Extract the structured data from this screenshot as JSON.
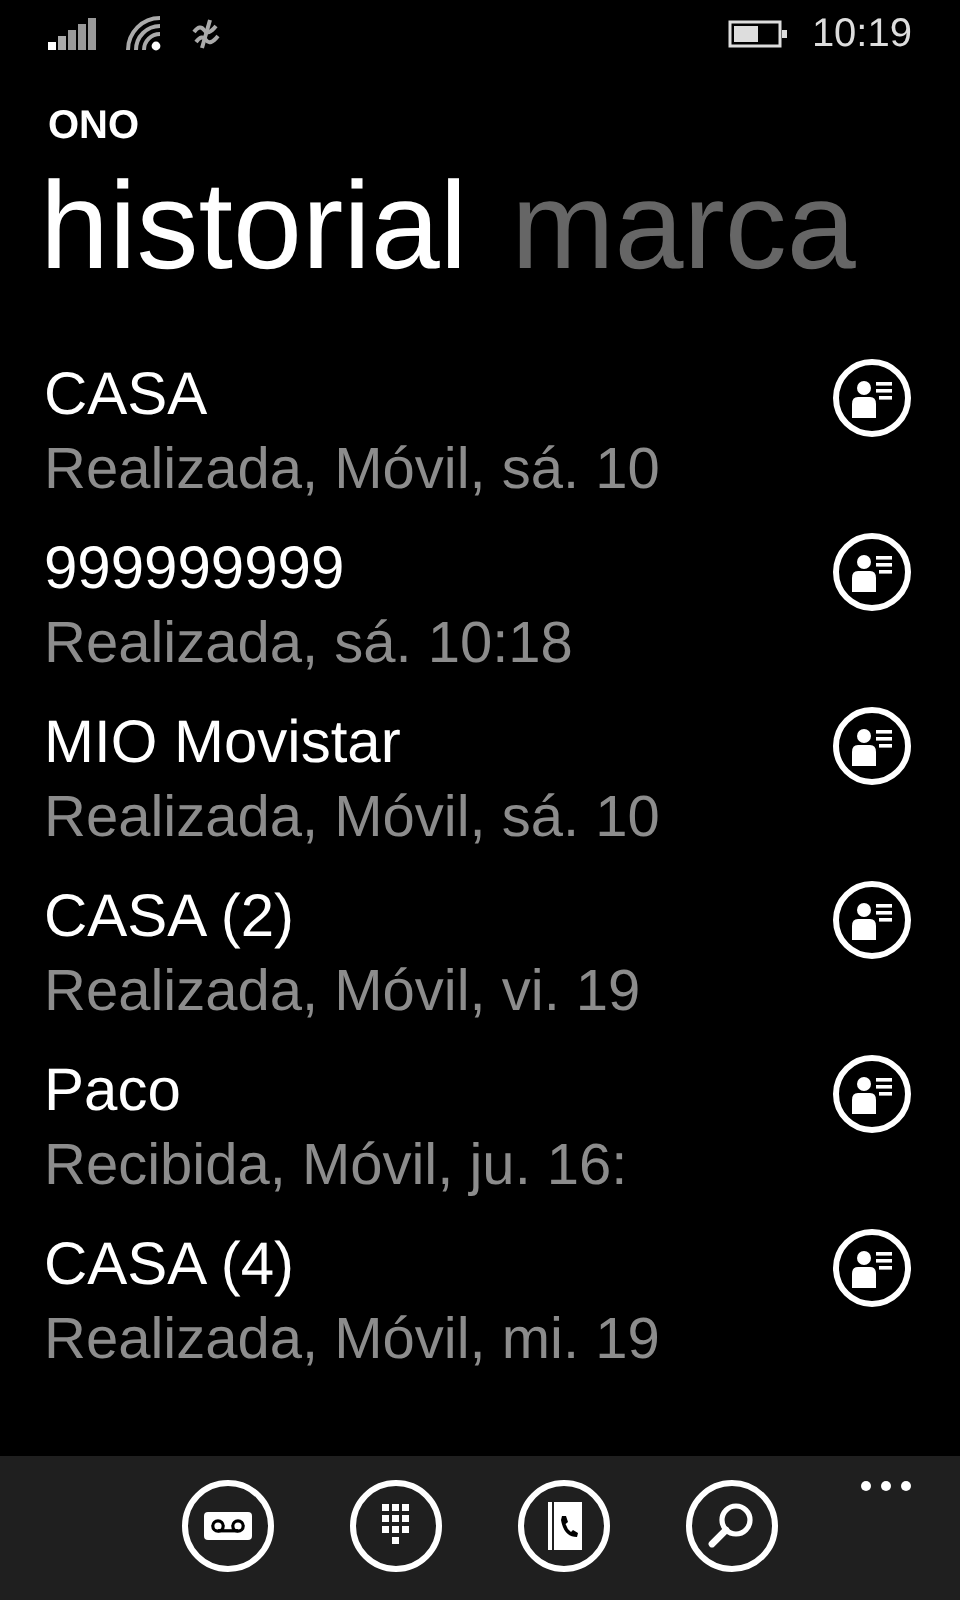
{
  "status_bar": {
    "time": "10:19"
  },
  "app_title": "ONO",
  "pivot": [
    {
      "label": "historial",
      "selected": true
    },
    {
      "label": "marca",
      "selected": false
    }
  ],
  "calls": [
    {
      "name": "CASA",
      "detail": "Realizada, Móvil, sá. 10"
    },
    {
      "name": "999999999",
      "detail": "Realizada, sá. 10:18"
    },
    {
      "name": "MIO Movistar",
      "detail": "Realizada, Móvil, sá. 10"
    },
    {
      "name": "CASA (2)",
      "detail": "Realizada, Móvil, vi. 19"
    },
    {
      "name": "Paco",
      "detail": "Recibida, Móvil, ju. 16:"
    },
    {
      "name": "CASA (4)",
      "detail": "Realizada, Móvil, mi. 19"
    }
  ],
  "app_bar": {
    "buttons": [
      {
        "kind": "voicemail"
      },
      {
        "kind": "keypad"
      },
      {
        "kind": "contacts"
      },
      {
        "kind": "search"
      }
    ]
  }
}
